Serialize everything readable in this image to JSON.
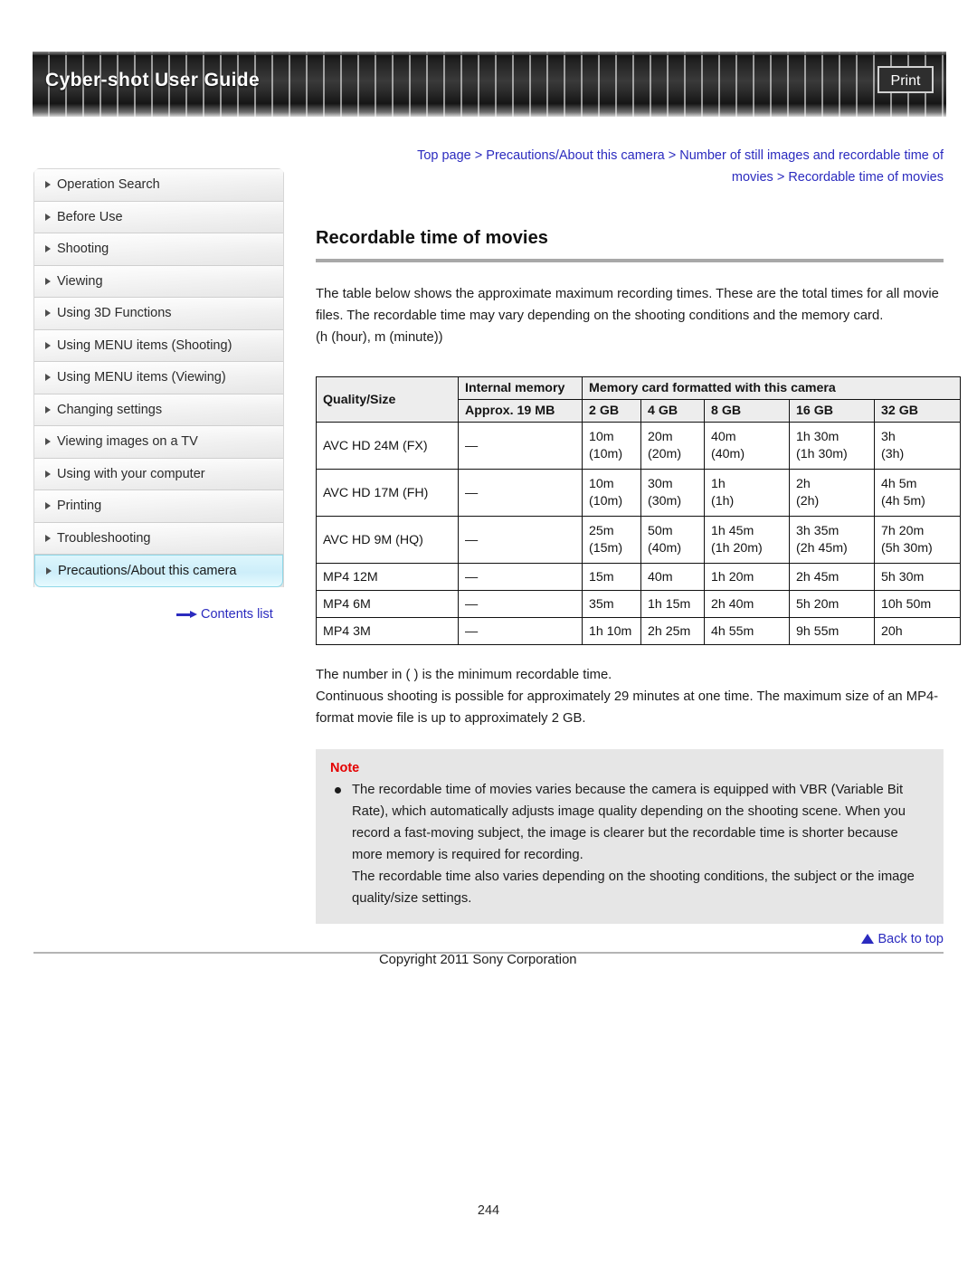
{
  "header": {
    "title": "Cyber-shot User Guide",
    "print_label": "Print"
  },
  "sidebar": {
    "items": [
      {
        "label": "Operation Search"
      },
      {
        "label": "Before Use"
      },
      {
        "label": "Shooting"
      },
      {
        "label": "Viewing"
      },
      {
        "label": "Using 3D Functions"
      },
      {
        "label": "Using MENU items (Shooting)"
      },
      {
        "label": "Using MENU items (Viewing)"
      },
      {
        "label": "Changing settings"
      },
      {
        "label": "Viewing images on a TV"
      },
      {
        "label": "Using with your computer"
      },
      {
        "label": "Printing"
      },
      {
        "label": "Troubleshooting"
      },
      {
        "label": "Precautions/About this camera"
      }
    ],
    "active_index": 12,
    "contents_link": "Contents list"
  },
  "breadcrumb": {
    "line1": "Top page > Precautions/About this camera > Number of still images and recordable time of",
    "line2": "movies > Recordable time of movies"
  },
  "main": {
    "title": "Recordable time of movies",
    "intro_paragraph": "The table below shows the approximate maximum recording times. These are the total times for all movie files. The recordable time may vary depending on the shooting conditions and the memory card.",
    "intro_units": "(h (hour), m (minute))",
    "post_table_line1": "The number in ( ) is the minimum recordable time.",
    "post_table_line2": "Continuous shooting is possible for approximately 29 minutes at one time. The maximum size of an MP4-format movie file is up to approximately 2 GB."
  },
  "table": {
    "group_header_quality": "Quality/Size",
    "group_header_internal": "Internal memory",
    "group_header_card": "Memory card formatted with this camera",
    "sub_headers": [
      "Approx. 19 MB",
      "2 GB",
      "4 GB",
      "8 GB",
      "16 GB",
      "32 GB"
    ],
    "rows": [
      {
        "quality": "AVC HD 24M (FX)",
        "internal": "—",
        "gb2": "10m",
        "gb2_min": "(10m)",
        "gb4": "20m",
        "gb4_min": "(20m)",
        "gb8": "40m",
        "gb8_min": "(40m)",
        "gb16": "1h 30m",
        "gb16_min": "(1h 30m)",
        "gb32": "3h",
        "gb32_min": "(3h)"
      },
      {
        "quality": "AVC HD 17M (FH)",
        "internal": "—",
        "gb2": "10m",
        "gb2_min": "(10m)",
        "gb4": "30m",
        "gb4_min": "(30m)",
        "gb8": "1h",
        "gb8_min": "(1h)",
        "gb16": "2h",
        "gb16_min": "(2h)",
        "gb32": "4h 5m",
        "gb32_min": "(4h 5m)"
      },
      {
        "quality": "AVC HD 9M (HQ)",
        "internal": "—",
        "gb2": "25m",
        "gb2_min": "(15m)",
        "gb4": "50m",
        "gb4_min": "(40m)",
        "gb8": "1h 45m",
        "gb8_min": "(1h 20m)",
        "gb16": "3h 35m",
        "gb16_min": "(2h 45m)",
        "gb32": "7h 20m",
        "gb32_min": "(5h 30m)"
      },
      {
        "quality": "MP4 12M",
        "internal": "—",
        "gb2": "15m",
        "gb2_min": "",
        "gb4": "40m",
        "gb4_min": "",
        "gb8": "1h 20m",
        "gb8_min": "",
        "gb16": "2h 45m",
        "gb16_min": "",
        "gb32": "5h 30m",
        "gb32_min": ""
      },
      {
        "quality": "MP4 6M",
        "internal": "—",
        "gb2": "35m",
        "gb2_min": "",
        "gb4": "1h 15m",
        "gb4_min": "",
        "gb8": "2h 40m",
        "gb8_min": "",
        "gb16": "5h 20m",
        "gb16_min": "",
        "gb32": "10h 50m",
        "gb32_min": ""
      },
      {
        "quality": "MP4 3M",
        "internal": "—",
        "gb2": "1h 10m",
        "gb2_min": "",
        "gb4": "2h 25m",
        "gb4_min": "",
        "gb8": "4h 55m",
        "gb8_min": "",
        "gb16": "9h 55m",
        "gb16_min": "",
        "gb32": "20h",
        "gb32_min": ""
      }
    ]
  },
  "note": {
    "heading": "Note",
    "paragraph1": "The recordable time of movies varies because the camera is equipped with VBR (Variable Bit Rate), which automatically adjusts image quality depending on the shooting scene. When you record a fast-moving subject, the image is clearer but the recordable time is shorter because more memory is required for recording.",
    "paragraph2": "The recordable time also varies depending on the shooting conditions, the subject or the image quality/size settings."
  },
  "footer": {
    "back_to_top": "Back to top",
    "copyright": "Copyright 2011 Sony Corporation",
    "page_number": "244"
  },
  "colors": {
    "link": "#2b2bbf",
    "note_heading": "#e40000",
    "active_nav": "#cdeefa",
    "table_header_bg": "#ededed"
  }
}
